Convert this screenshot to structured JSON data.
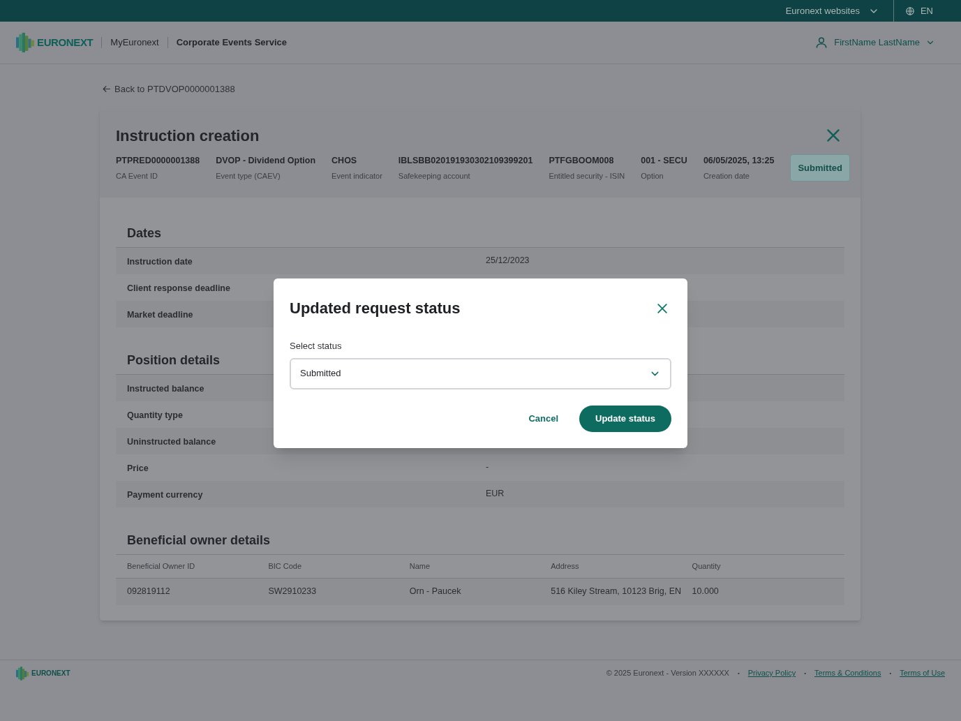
{
  "top_bar": {
    "websites": "Euronext websites",
    "language": "EN"
  },
  "header": {
    "brand": "EURONEXT",
    "app": "MyEuronext",
    "service": "Corporate Events Service",
    "user": "FirstName LastName"
  },
  "back_link": "Back to PTDVOP0000001388",
  "instruction": {
    "title": "Instruction creation",
    "status": "Submitted",
    "fields": [
      {
        "value": "PTPRED0000001388",
        "label": "CA Event ID"
      },
      {
        "value": "DVOP - Dividend Option",
        "label": "Event type (CAEV)"
      },
      {
        "value": "CHOS",
        "label": "Event indicator"
      },
      {
        "value": "IBLSBB020191930302109399201",
        "label": "Safekeeping account"
      },
      {
        "value": "PTFGBOOM008",
        "label": "Entitled security - ISIN"
      },
      {
        "value": "001 - SECU",
        "label": "Option"
      },
      {
        "value": "06/05/2025, 13:25",
        "label": "Creation date"
      }
    ]
  },
  "sections": [
    {
      "title": "Dates",
      "rows": [
        {
          "label": "Instruction date",
          "value": "25/12/2023"
        },
        {
          "label": "Client response deadline"
        },
        {
          "label": "Market deadline"
        }
      ]
    },
    {
      "title": "Position details",
      "rows": [
        {
          "label": "Instructed balance"
        },
        {
          "label": "Quantity type"
        },
        {
          "label": "Uninstructed balance"
        },
        {
          "label": "Price",
          "value": "-"
        },
        {
          "label": "Payment currency",
          "value": "EUR"
        }
      ]
    }
  ],
  "beneficial_owners": {
    "title": "Beneficial owner details",
    "columns": [
      "Beneficial Owner ID",
      "BIC Code",
      "Name",
      "Address",
      "Quantity"
    ],
    "rows": [
      [
        "092819112",
        "SW2910233",
        "Orn - Paucek",
        "516 Kiley Stream, 10123 Brig, EN",
        "10.000"
      ]
    ]
  },
  "dialog": {
    "title": "Updated request status",
    "field_label": "Select status",
    "value": "Submitted",
    "cancel": "Cancel",
    "confirm": "Update status"
  },
  "footer": {
    "brand": "EURONEXT",
    "copyright": "© 2025 Euronext - Version XXXXXX",
    "separator": "•",
    "links": [
      "Privacy Policy",
      "Terms & Conditions",
      "Terms of Use"
    ]
  }
}
